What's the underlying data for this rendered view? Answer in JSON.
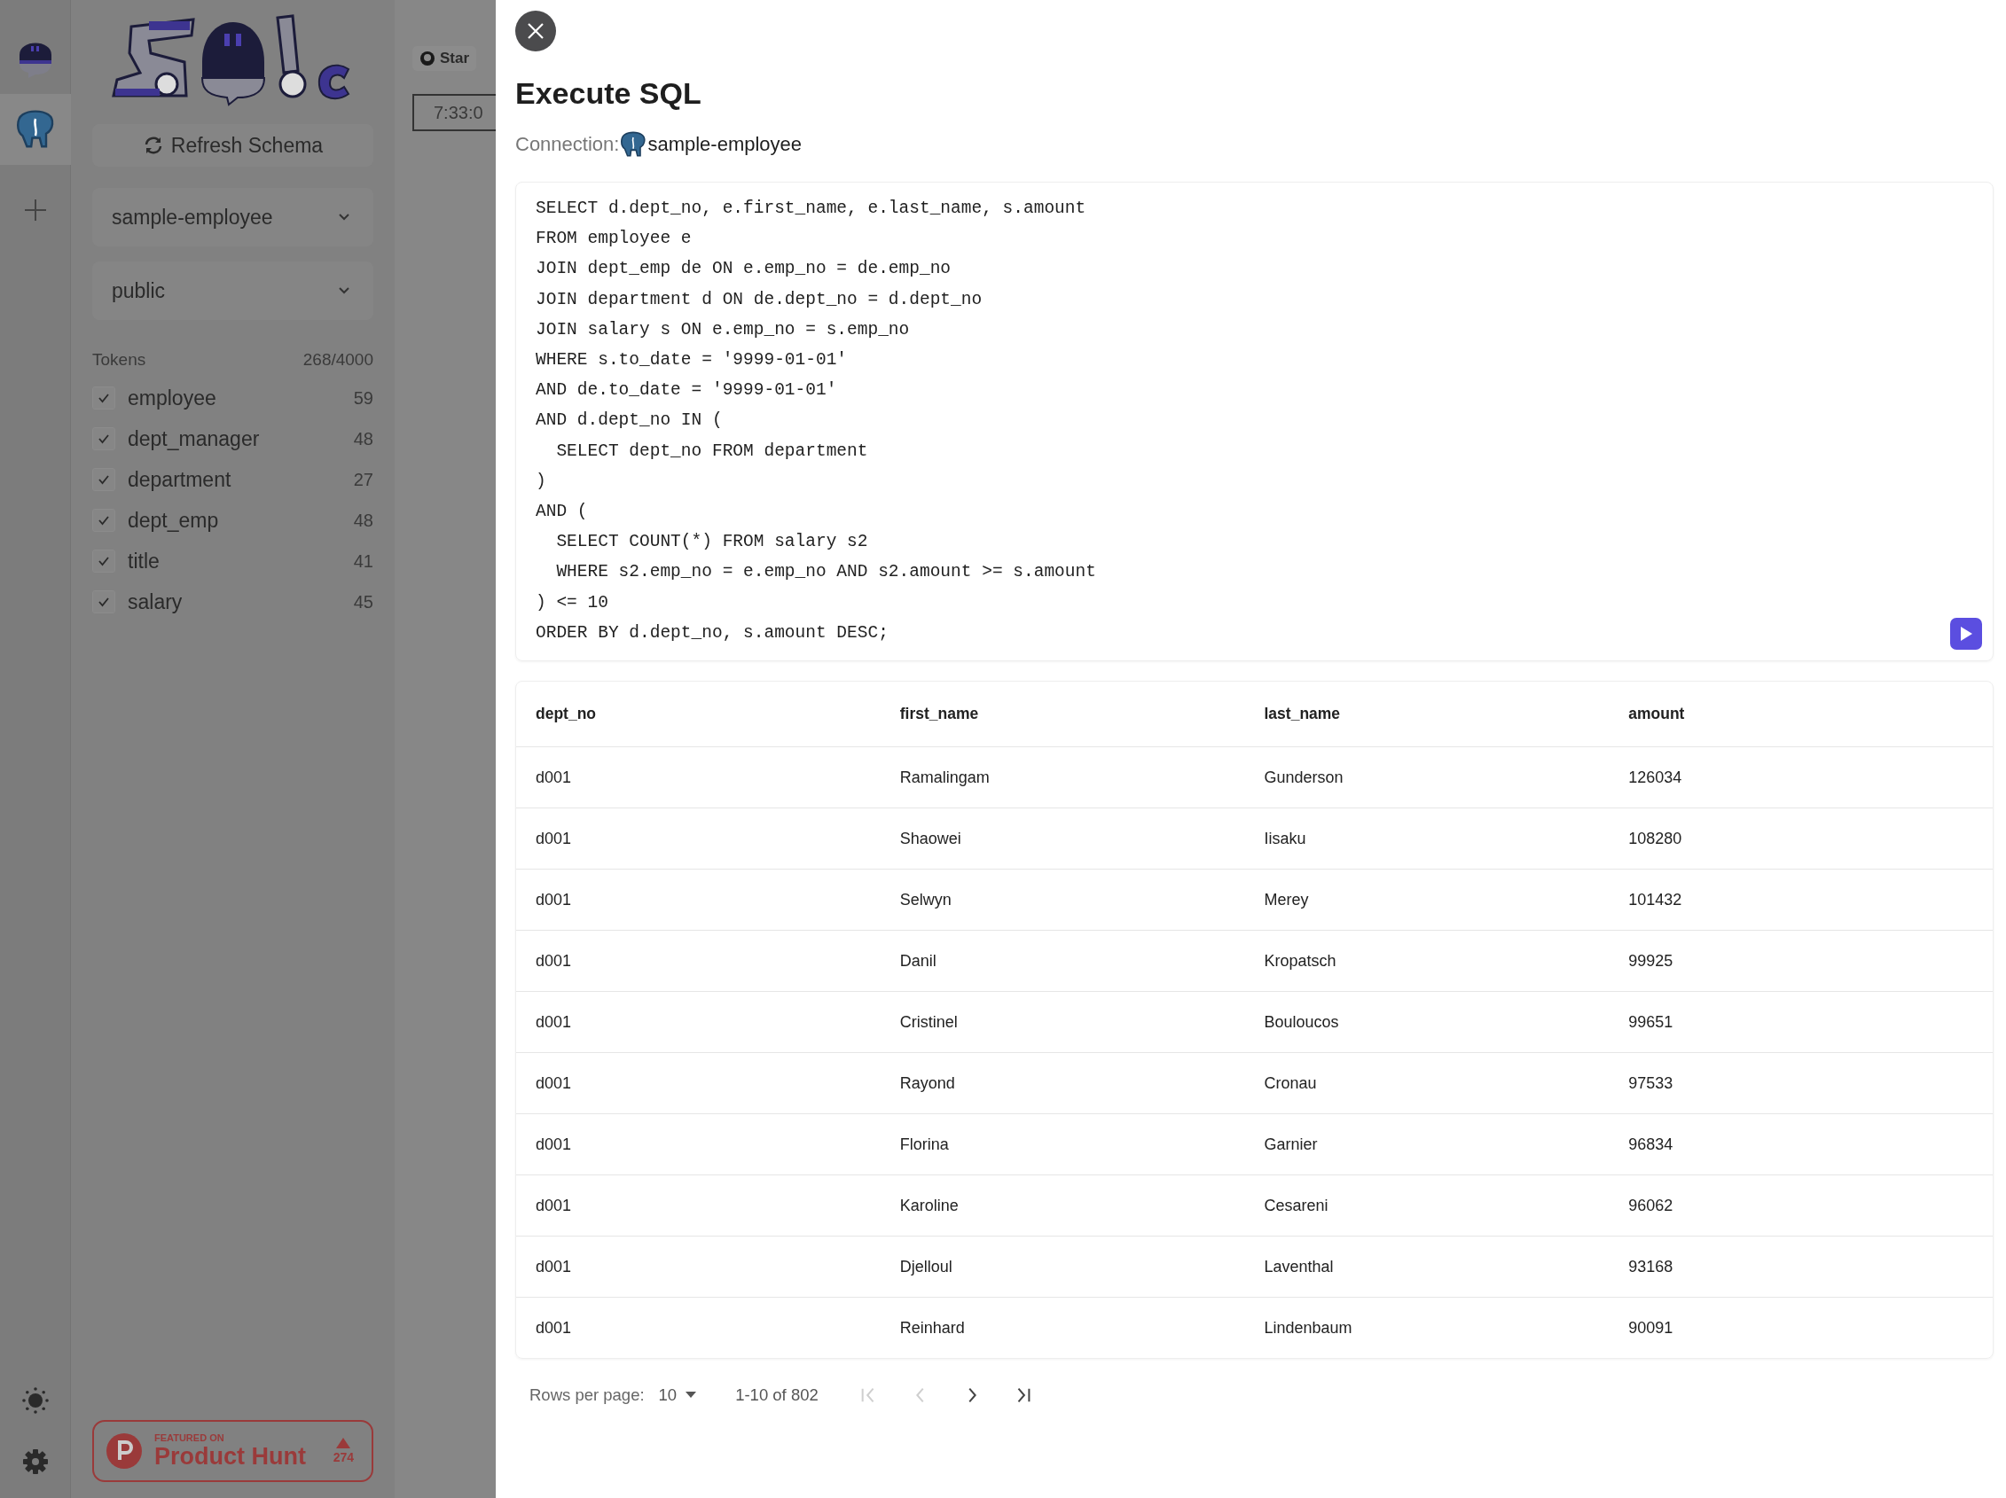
{
  "rail": {
    "connections": [
      {
        "selected": true
      }
    ]
  },
  "sidebar": {
    "refresh_button": "Refresh Schema",
    "connection_select": "sample-employee",
    "schema_select": "public",
    "tokens": {
      "label": "Tokens",
      "value": "268/4000"
    },
    "tables": [
      {
        "name": "employee",
        "tokens": "59",
        "checked": true
      },
      {
        "name": "dept_manager",
        "tokens": "48",
        "checked": true
      },
      {
        "name": "department",
        "tokens": "27",
        "checked": true
      },
      {
        "name": "dept_emp",
        "tokens": "48",
        "checked": true
      },
      {
        "name": "title",
        "tokens": "41",
        "checked": true
      },
      {
        "name": "salary",
        "tokens": "45",
        "checked": true
      }
    ],
    "product_hunt": {
      "featured": "FEATURED ON",
      "name": "Product Hunt",
      "votes": "274"
    }
  },
  "header": {
    "star_button": "Star",
    "time_field": "7:33:0"
  },
  "drawer": {
    "title": "Execute SQL",
    "connection_label": "Connection:",
    "connection_name": "sample-employee",
    "sql": [
      "SELECT d.dept_no, e.first_name, e.last_name, s.amount",
      "FROM employee e",
      "JOIN dept_emp de ON e.emp_no = de.emp_no",
      "JOIN department d ON de.dept_no = d.dept_no",
      "JOIN salary s ON e.emp_no = s.emp_no",
      "WHERE s.to_date = '9999-01-01'",
      "AND de.to_date = '9999-01-01'",
      "AND d.dept_no IN (",
      "  SELECT dept_no FROM department",
      ")",
      "AND (",
      "  SELECT COUNT(*) FROM salary s2",
      "  WHERE s2.emp_no = e.emp_no AND s2.amount >= s.amount",
      ") <= 10",
      "ORDER BY d.dept_no, s.amount DESC;"
    ],
    "table": {
      "columns": [
        "dept_no",
        "first_name",
        "last_name",
        "amount"
      ],
      "rows": [
        [
          "d001",
          "Ramalingam",
          "Gunderson",
          "126034"
        ],
        [
          "d001",
          "Shaowei",
          "Iisaku",
          "108280"
        ],
        [
          "d001",
          "Selwyn",
          "Merey",
          "101432"
        ],
        [
          "d001",
          "Danil",
          "Kropatsch",
          "99925"
        ],
        [
          "d001",
          "Cristinel",
          "Bouloucos",
          "99651"
        ],
        [
          "d001",
          "Rayond",
          "Cronau",
          "97533"
        ],
        [
          "d001",
          "Florina",
          "Garnier",
          "96834"
        ],
        [
          "d001",
          "Karoline",
          "Cesareni",
          "96062"
        ],
        [
          "d001",
          "Djelloul",
          "Laventhal",
          "93168"
        ],
        [
          "d001",
          "Reinhard",
          "Lindenbaum",
          "90091"
        ]
      ]
    },
    "pagination": {
      "rows_per_page_label": "Rows per page:",
      "rows_per_page": "10",
      "range": "1-10 of 802",
      "buttons": [
        {
          "kind": "first",
          "disabled": true
        },
        {
          "kind": "prev",
          "disabled": true
        },
        {
          "kind": "next",
          "disabled": false
        },
        {
          "kind": "last",
          "disabled": false
        }
      ]
    }
  }
}
